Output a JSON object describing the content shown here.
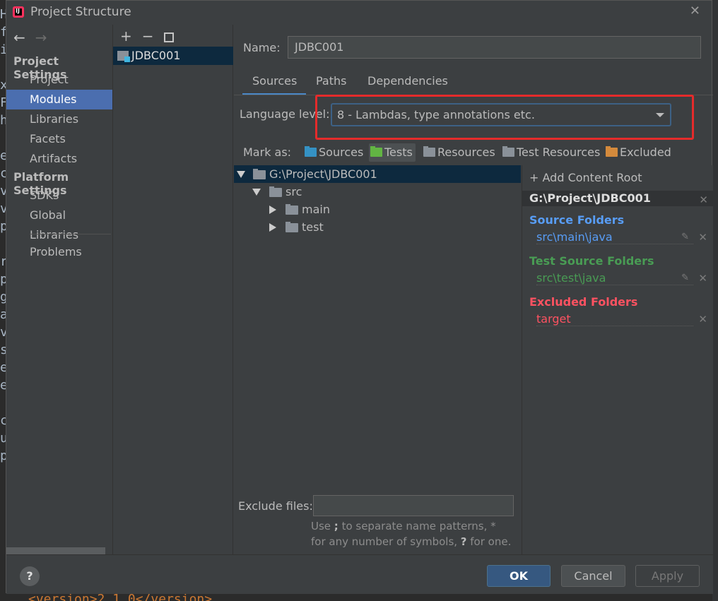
{
  "window": {
    "title": "Project Structure"
  },
  "background": {
    "editor_letters": [
      "H",
      "f",
      "i",
      "",
      "x",
      "F",
      "h",
      "",
      "e",
      "c",
      "v",
      "v",
      "p",
      "",
      "r",
      "p",
      "g",
      "a",
      "v",
      "s",
      "e",
      "e",
      "",
      "c",
      "u",
      "p"
    ],
    "bottom_text": "<version>2.1.0</version>"
  },
  "nav": {
    "project_settings": "Project Settings",
    "project_items": [
      "Project",
      "Modules",
      "Libraries",
      "Facets",
      "Artifacts"
    ],
    "platform_settings": "Platform Settings",
    "platform_items": [
      "SDKs",
      "Global Libraries"
    ],
    "problems": "Problems",
    "selected": "Modules"
  },
  "modules": {
    "items": [
      "JDBC001"
    ]
  },
  "name": {
    "label": "Name:",
    "value": "JDBC001"
  },
  "tabs": {
    "items": [
      "Sources",
      "Paths",
      "Dependencies"
    ],
    "active": "Sources"
  },
  "language_level": {
    "label": "Language level:",
    "value": "8 - Lambdas, type annotations etc."
  },
  "mark_as": {
    "label": "Mark as:",
    "buttons": [
      {
        "label": "Sources",
        "color": "#3592c4"
      },
      {
        "label": "Tests",
        "color": "#62b543"
      },
      {
        "label": "Resources",
        "color": "#8a9199"
      },
      {
        "label": "Test Resources",
        "color": "#8a9199"
      },
      {
        "label": "Excluded",
        "color": "#d48a3c"
      }
    ]
  },
  "tree": {
    "root": "G:\\Project\\JDBC001",
    "src": "src",
    "main": "main",
    "test": "test"
  },
  "exclude": {
    "label": "Exclude files:",
    "value": "",
    "hint_line1_a": "Use ",
    "hint_line1_b": ";",
    "hint_line1_c": " to separate name patterns, ",
    "hint_line1_d": "*",
    "hint_line2_a": "for any number of symbols, ",
    "hint_line2_b": "?",
    "hint_line2_c": " for one."
  },
  "content_roots": {
    "add_label": "Add Content Root",
    "root_path": "G:\\Project\\JDBC001",
    "source_title": "Source Folders",
    "source_item": "src\\main\\java",
    "test_title": "Test Source Folders",
    "test_item": "src\\test\\java",
    "excluded_title": "Excluded Folders",
    "excluded_item": "target",
    "colors": {
      "source": "#589df6",
      "test": "#499c54",
      "excluded": "#ff5261"
    }
  },
  "buttons": {
    "help": "?",
    "ok": "OK",
    "cancel": "Cancel",
    "apply": "Apply"
  }
}
